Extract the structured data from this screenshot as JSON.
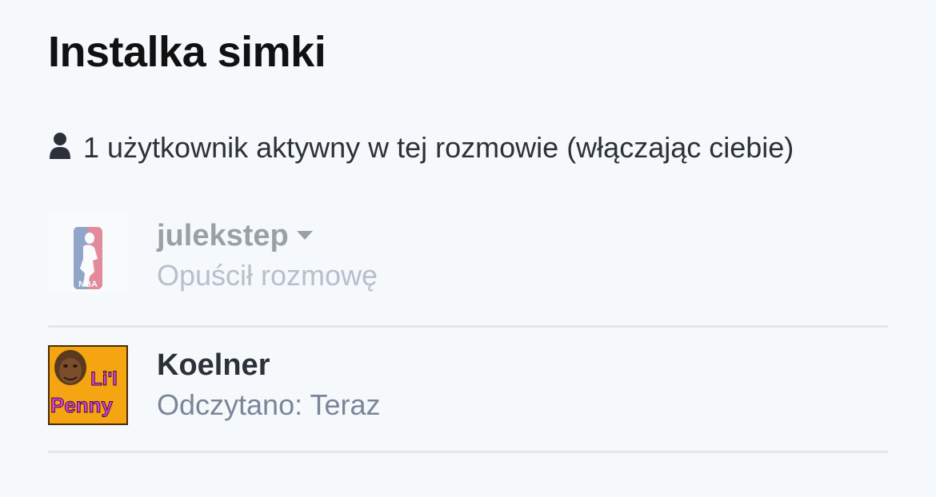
{
  "conversation": {
    "title": "Instalka simki",
    "active_users_text": "1 użytkownik aktywny w tej rozmowie (włączając ciebie)",
    "active_users_icon": "user-icon"
  },
  "participants": [
    {
      "username": "julekstep",
      "status": "Opuścił rozmowę",
      "has_menu": true,
      "avatar": "nba-logo"
    },
    {
      "username": "Koelner",
      "status": "Odczytano: Teraz",
      "has_menu": false,
      "avatar": "lil-penny",
      "avatar_text_1": "Li'l",
      "avatar_text_2": "Penny"
    }
  ]
}
